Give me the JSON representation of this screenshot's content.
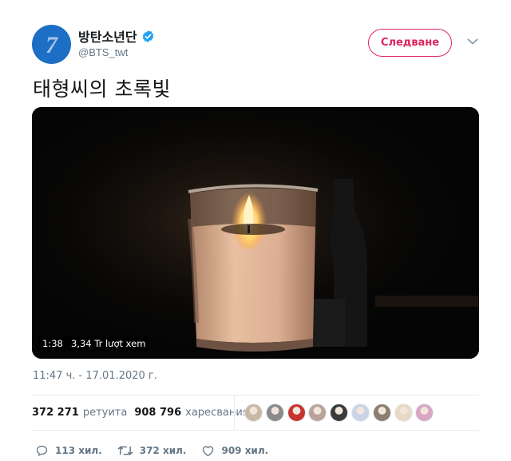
{
  "author": {
    "display_name": "방탄소년단",
    "handle": "@BTS_twt",
    "avatar_glyph": "7",
    "verified": true
  },
  "follow_button_label": "Следване",
  "tweet_text": "태형씨의 초록빛",
  "video": {
    "duration": "1:38",
    "views": "3,34 Tr lượt xem"
  },
  "timestamp": "11:47 ч. - 17.01.2020 г.",
  "stats": {
    "retweets_count": "372 271",
    "retweets_label": "ретуита",
    "likes_count": "908 796",
    "likes_label": "харесвания"
  },
  "likers": [
    {
      "color": "#c9b8a4"
    },
    {
      "color": "#8a8a8a"
    },
    {
      "color": "#c8342f"
    },
    {
      "color": "#b9a398"
    },
    {
      "color": "#3b3b3b"
    },
    {
      "color": "#c9d4e6"
    },
    {
      "color": "#8c7f70"
    },
    {
      "color": "#e8d9c4"
    },
    {
      "color": "#d9a6c4"
    }
  ],
  "actions": {
    "reply_count": "113 хил.",
    "retweet_count": "372 хил.",
    "like_count": "909 хил."
  },
  "colors": {
    "accent": "#e0245e",
    "verified": "#1da1f2",
    "muted_text": "#657786",
    "avatar_bg": "#1c6fc4"
  }
}
